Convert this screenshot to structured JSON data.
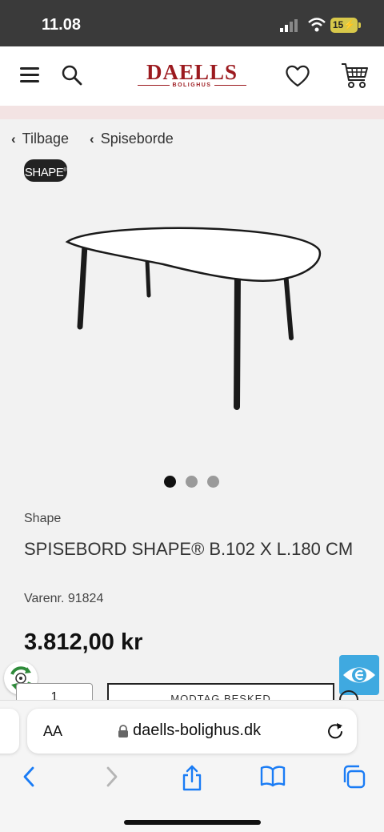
{
  "status_bar": {
    "time": "11.08",
    "battery": "15"
  },
  "header": {
    "logo_brand": "DAELLS",
    "logo_sub": "BOLIGHUS",
    "icons": [
      "menu-icon",
      "search-icon",
      "heart-icon",
      "cart-icon"
    ]
  },
  "breadcrumb": [
    {
      "label": "Tilbage"
    },
    {
      "label": "Spiseborde"
    }
  ],
  "brand_badge": "SHAPE",
  "carousel": {
    "count": 3,
    "active": 0
  },
  "product": {
    "brand": "Shape",
    "title": "SPISEBORD SHAPE® B.102 X L.180 CM",
    "sku": "Varenr. 91824",
    "price": "3.812,00 kr",
    "quantity": "1",
    "notify_label": "MODTAG BESKED"
  },
  "colors": {
    "brand_red": "#9c1a1f",
    "eye_badge": "#3fa9e0",
    "ios_blue": "#1a7cf5"
  },
  "safari": {
    "aa_label": "AA",
    "url": "daells-bolighus.dk",
    "toolbar_icons": [
      "back-icon",
      "forward-icon",
      "share-icon",
      "bookmarks-icon",
      "tabs-icon"
    ]
  }
}
